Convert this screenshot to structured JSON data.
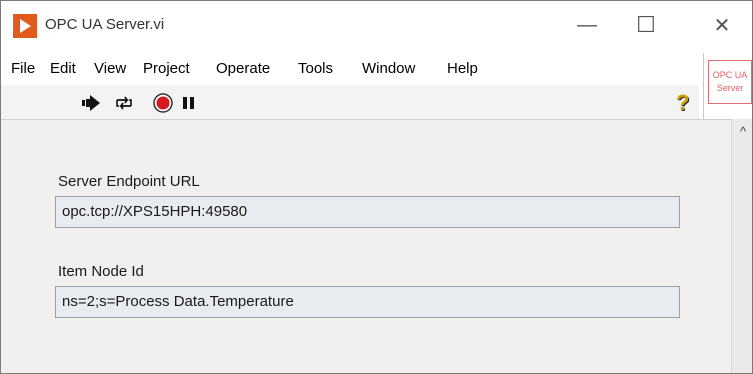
{
  "window": {
    "title": "OPC UA Server.vi",
    "minimize": "—",
    "maximize": "☐",
    "close": "✕"
  },
  "menu": {
    "items": [
      "File",
      "Edit",
      "View",
      "Project",
      "Operate",
      "Tools",
      "Window",
      "Help"
    ]
  },
  "toolbar": {
    "run_icon": "run-arrow-icon",
    "run_continuous_icon": "run-continuously-icon",
    "abort_icon": "abort-stop-icon",
    "pause_icon": "pause-icon",
    "help_icon": "context-help-icon",
    "help_glyph": "?"
  },
  "connector_pane": {
    "line1": "OPC UA",
    "line2": "Server"
  },
  "fields": {
    "endpoint_label": "Server Endpoint URL",
    "endpoint_value": "opc.tcp://XPS15HPH:49580",
    "node_label": "Item Node Id",
    "node_value": "ns=2;s=Process Data.Temperature"
  },
  "scrollbar": {
    "up_arrow": "^"
  },
  "colors": {
    "accent": "#e25a1c",
    "panel": "#f0f0f0",
    "field": "#e8ecf0"
  }
}
